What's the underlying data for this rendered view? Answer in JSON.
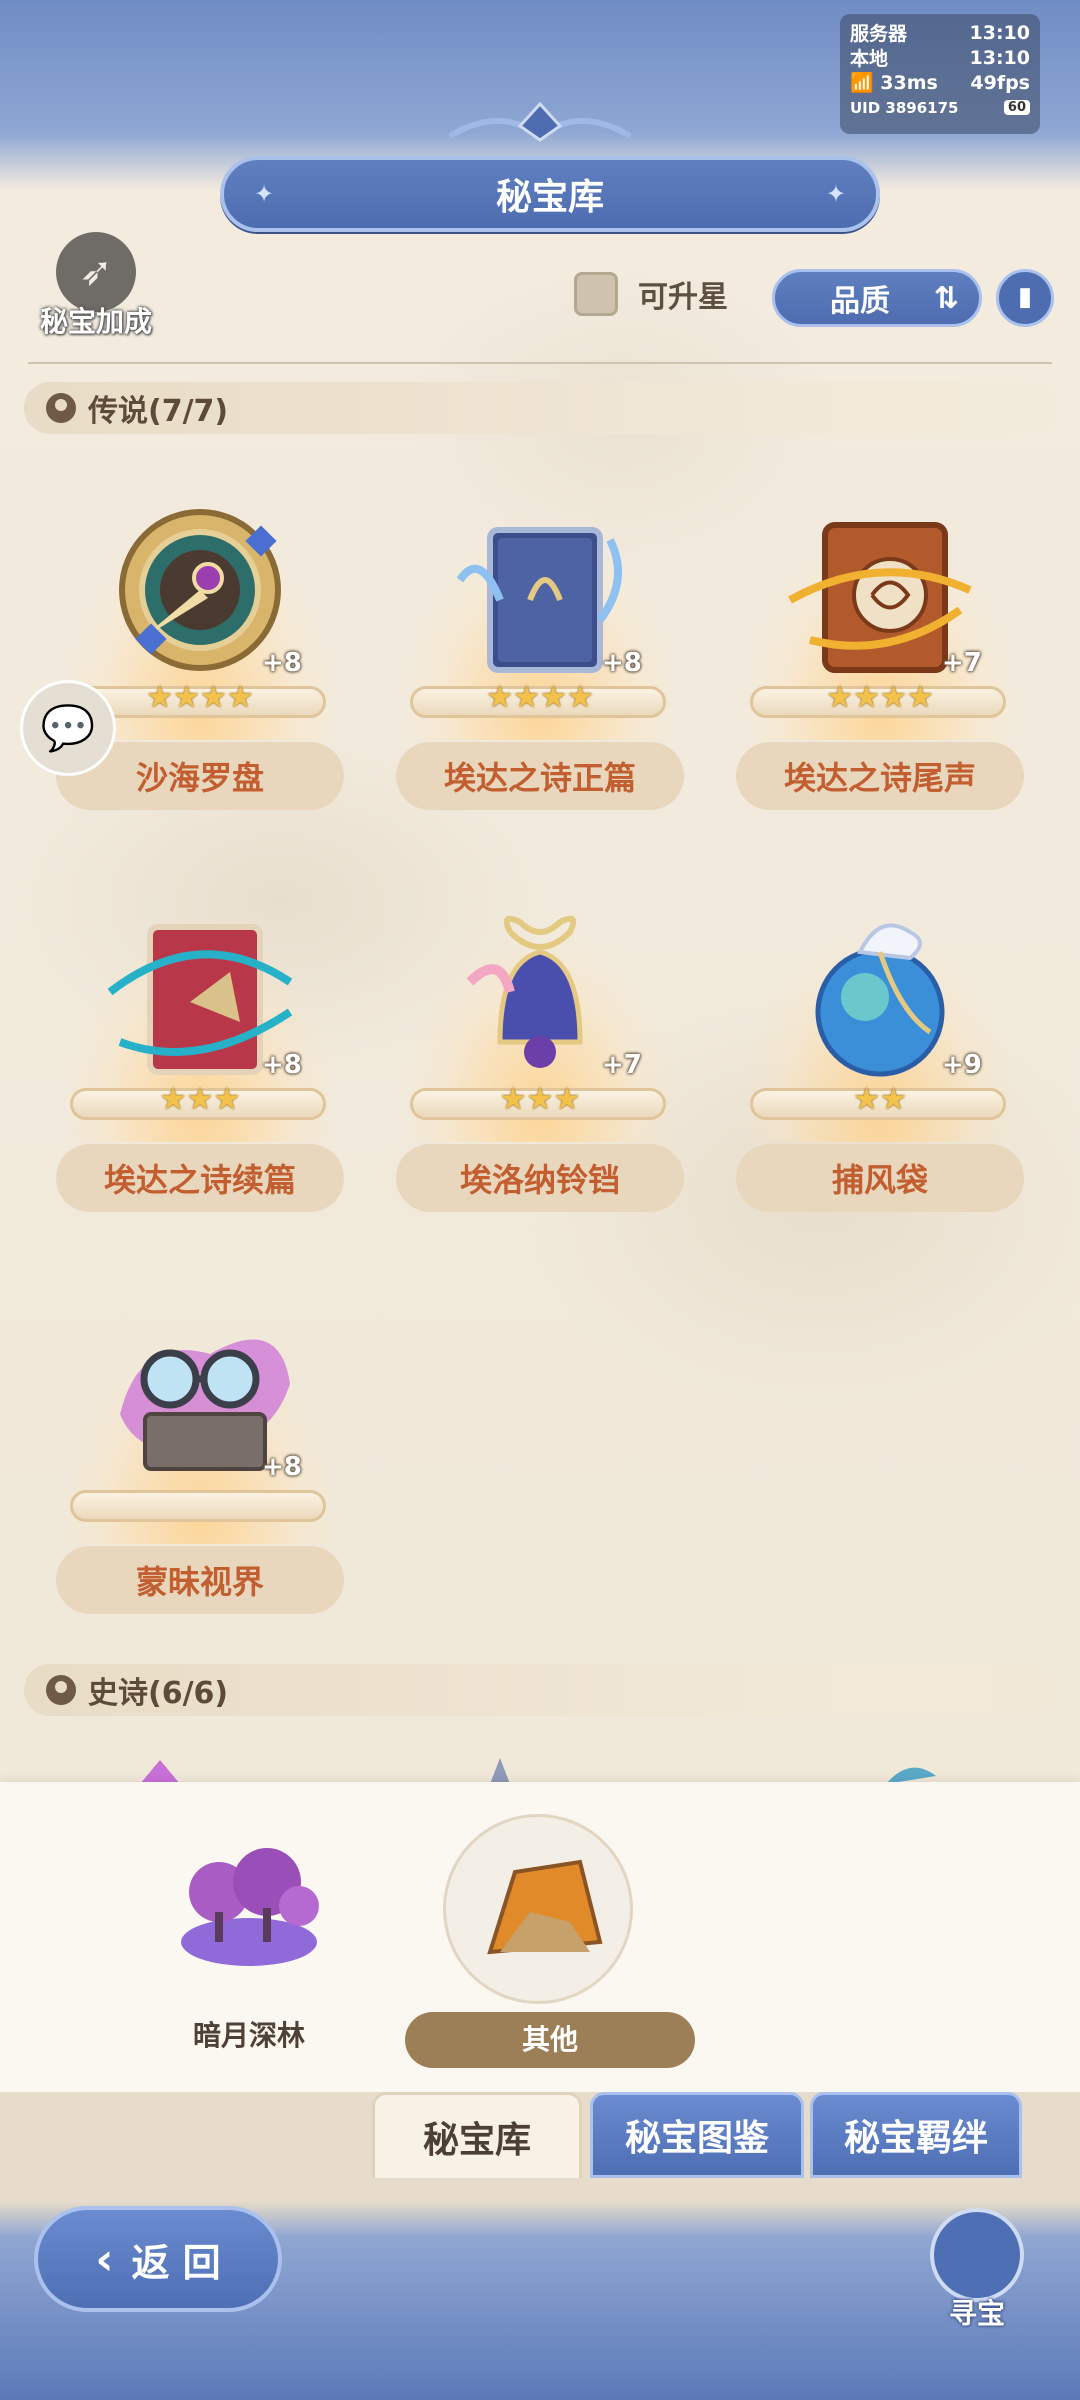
{
  "status": {
    "server_label": "服务器",
    "server_time": "13:10",
    "local_label": "本地",
    "local_time": "13:10",
    "ping": "33ms",
    "fps": "49fps",
    "uid": "UID 3896175",
    "battery": "60"
  },
  "header": {
    "title": "秘宝库"
  },
  "bonus": {
    "label": "秘宝加成"
  },
  "filter": {
    "upgradable_label": "可升星",
    "sort_label": "品质"
  },
  "sections": [
    {
      "title": "传说(7/7)"
    },
    {
      "title": "史诗(6/6)"
    }
  ],
  "items": [
    {
      "name": "沙海罗盘",
      "level": "+8",
      "stars": "★★★★",
      "star_count": 4
    },
    {
      "name": "埃达之诗正篇",
      "level": "+8",
      "stars": "★★★★",
      "star_count": 4
    },
    {
      "name": "埃达之诗尾声",
      "level": "+7",
      "stars": "★★★★",
      "star_count": 4
    },
    {
      "name": "埃达之诗续篇",
      "level": "+8",
      "stars": "★★★",
      "star_count": 3
    },
    {
      "name": "埃洛纳铃铛",
      "level": "+7",
      "stars": "★★★",
      "star_count": 3
    },
    {
      "name": "捕风袋",
      "level": "+9",
      "stars": "★★",
      "star_count": 2
    },
    {
      "name": "蒙昧视界",
      "level": "+8",
      "stars": "",
      "star_count": 0
    }
  ],
  "regions": [
    {
      "label": "暗月深林",
      "selected": false
    },
    {
      "label": "其他",
      "selected": true
    }
  ],
  "tabs": [
    {
      "label": "秘宝库",
      "active": true
    },
    {
      "label": "秘宝图鉴",
      "active": false
    },
    {
      "label": "秘宝羁绊",
      "active": false
    }
  ],
  "footer": {
    "back_label": "返 回",
    "treasure_label": "寻宝"
  }
}
